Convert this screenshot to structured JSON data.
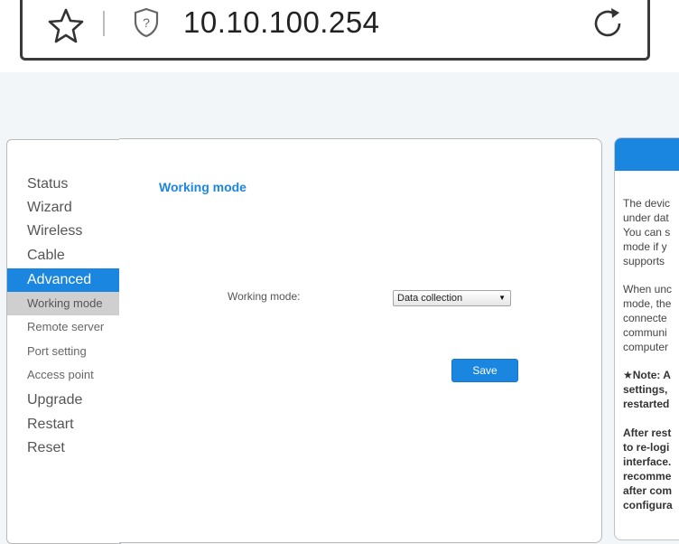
{
  "browser": {
    "url": "10.10.100.254",
    "icons": [
      "star-icon",
      "shield-question-icon",
      "reload-icon"
    ]
  },
  "menu": {
    "items": [
      {
        "label": "Status"
      },
      {
        "label": "Wizard"
      },
      {
        "label": "Wireless"
      },
      {
        "label": "Cable"
      },
      {
        "label": "Advanced"
      },
      {
        "label": "Working mode"
      },
      {
        "label": "Remote server"
      },
      {
        "label": "Port setting"
      },
      {
        "label": "Access point"
      },
      {
        "label": "Upgrade"
      },
      {
        "label": "Restart"
      },
      {
        "label": "Reset"
      }
    ],
    "active": "Advanced",
    "selected_sub": "Working mode"
  },
  "main": {
    "title": "Working mode",
    "field_label": "Working mode:",
    "select_value": "Data collection",
    "save_label": "Save"
  },
  "help": {
    "para1": "The devic\nunder dat\nYou can s\nmode if y\nsupports",
    "para2": "When unc\nmode, the\nconnecte\ncommuni\ncomputer",
    "note": "★Note: A\nsettings,\nrestarted",
    "para3": "After rest\nto re-logi\ninterface.\nrecomme\nafter com\nconfigura"
  },
  "colors": {
    "accent": "#1a86e0",
    "sub_selected_bg": "#cfcfcf",
    "page_bg": "#f3f6f9"
  }
}
